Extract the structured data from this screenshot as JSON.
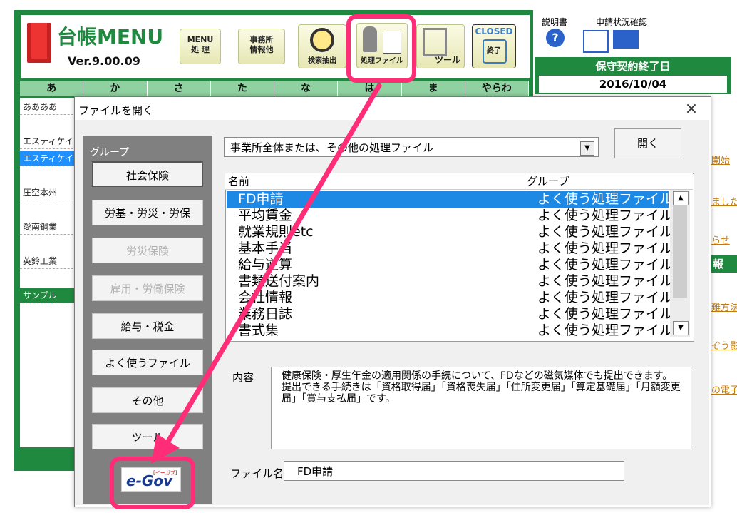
{
  "app": {
    "title": "台帳MENU",
    "version": "Ver.9.00.09",
    "toolbar": {
      "menu_btn": "MENU\n処 理",
      "office_btn": "事務所\n情報他",
      "search_btn": "検索抽出",
      "process_btn": "処理ファイル",
      "tool_btn": "ツール",
      "closed_btn": "CLOSED",
      "closed_sub": "終了"
    },
    "kana_tabs": [
      "あ",
      "か",
      "さ",
      "た",
      "な",
      "は",
      "ま",
      "やらわ"
    ],
    "companies": [
      "ああああ",
      "エスティケイ",
      "エスティケイ",
      "圧空本州",
      "愛南鋼業",
      "英鈴工業",
      "サンプル"
    ],
    "help_label": "説明書",
    "status_label": "申請状況確認",
    "maint_label": "保守契約終了日",
    "maint_date": "2016/10/04",
    "right_links": [
      "開始",
      "ました",
      "らせ",
      "報",
      "難方法",
      "ぞう影響",
      "の電子"
    ]
  },
  "dialog": {
    "title": "ファイルを開く",
    "close": "×",
    "group_label": "グループ",
    "groups": [
      {
        "label": "社会保険",
        "disabled": false
      },
      {
        "label": "労基・労災・労保",
        "disabled": false
      },
      {
        "label": "労災保険",
        "disabled": true
      },
      {
        "label": "雇用・労働保険",
        "disabled": true
      },
      {
        "label": "給与・税金",
        "disabled": false
      },
      {
        "label": "よく使うファイル",
        "disabled": false
      },
      {
        "label": "その他",
        "disabled": false
      },
      {
        "label": "ツール",
        "disabled": false
      }
    ],
    "egov_label": "e-Gov",
    "egov_small": "[イーガブ]",
    "combo_value": "事業所全体または、その他の処理ファイル",
    "open_button": "開く",
    "col_name": "名前",
    "col_group": "グループ",
    "rows": [
      {
        "name": "FD申請",
        "group": "よく使う処理ファイル"
      },
      {
        "name": "平均賃金",
        "group": "よく使う処理ファイル"
      },
      {
        "name": "就業規則etc",
        "group": "よく使う処理ファイル"
      },
      {
        "name": "基本手当",
        "group": "よく使う処理ファイル"
      },
      {
        "name": "給与逆算",
        "group": "よく使う処理ファイル"
      },
      {
        "name": "書類送付案内",
        "group": "よく使う処理ファイル"
      },
      {
        "name": "会社情報",
        "group": "よく使う処理ファイル"
      },
      {
        "name": "業務日誌",
        "group": "よく使う処理ファイル"
      },
      {
        "name": "書式集",
        "group": "よく使う処理ファイル"
      }
    ],
    "content_label": "内容",
    "content_text": "健康保険・厚生年金の適用関係の手続について、FDなどの磁気媒体でも提出できます。提出できる手続きは「資格取得届」「資格喪失届」「住所変更届」「算定基礎届」「月額変更届」「賞与支払届」です。",
    "filename_label": "ファイル名",
    "filename_value": "FD申請"
  },
  "colors": {
    "green": "#1f8a3f",
    "highlight": "#ff2d77",
    "selection": "#1e88e5"
  }
}
